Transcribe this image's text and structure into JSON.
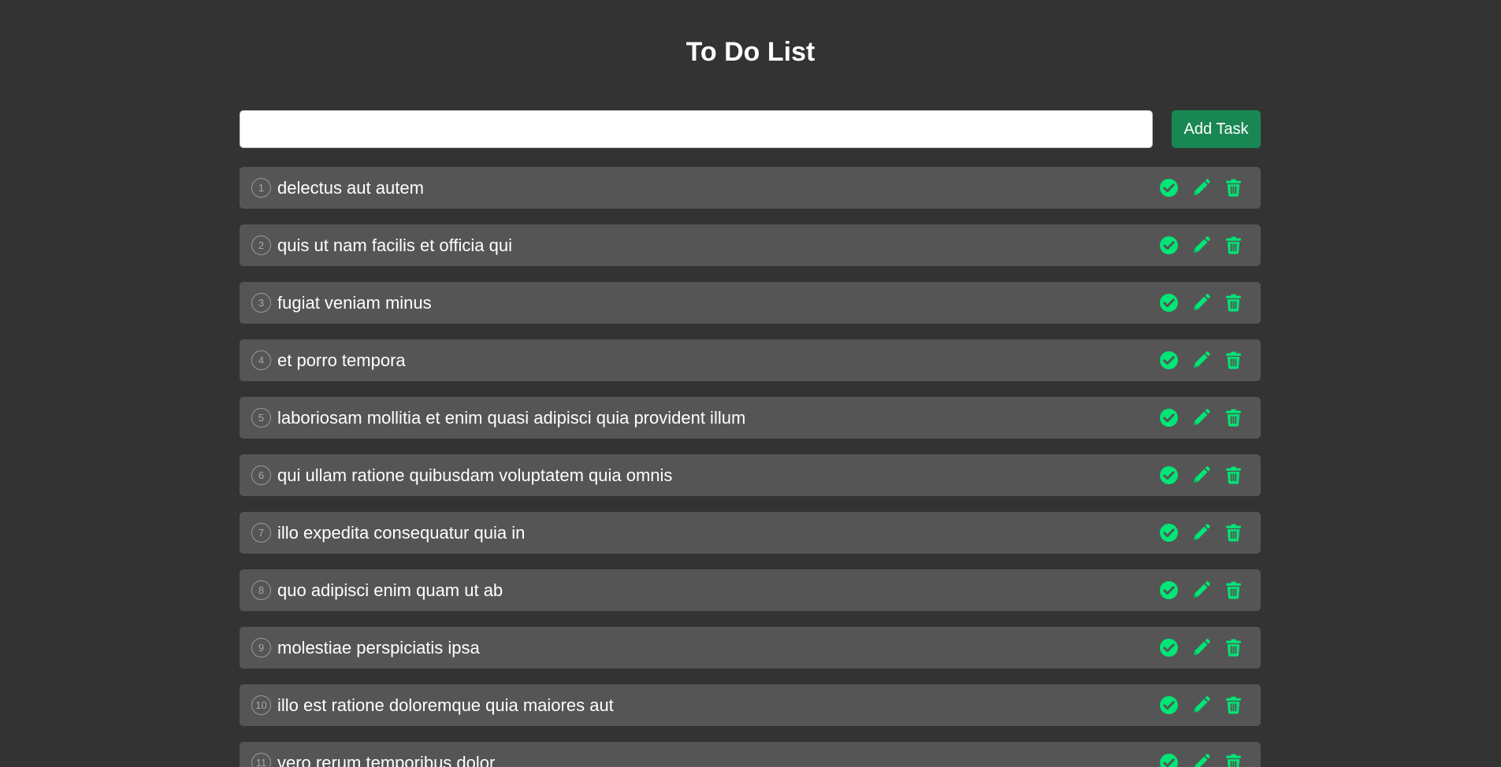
{
  "app": {
    "title": "To Do List"
  },
  "add_form": {
    "input_value": "",
    "placeholder": "",
    "button_label": "Add Task"
  },
  "colors": {
    "background": "#333333",
    "item_background": "#555555",
    "accent": "#00e676",
    "button": "#198754"
  },
  "icons": {
    "complete": "check-circle-icon",
    "edit": "pencil-icon",
    "delete": "trash-icon"
  },
  "tasks": [
    {
      "number": "1",
      "text": "delectus aut autem"
    },
    {
      "number": "2",
      "text": "quis ut nam facilis et officia qui"
    },
    {
      "number": "3",
      "text": "fugiat veniam minus"
    },
    {
      "number": "4",
      "text": "et porro tempora"
    },
    {
      "number": "5",
      "text": "laboriosam mollitia et enim quasi adipisci quia provident illum"
    },
    {
      "number": "6",
      "text": "qui ullam ratione quibusdam voluptatem quia omnis"
    },
    {
      "number": "7",
      "text": "illo expedita consequatur quia in"
    },
    {
      "number": "8",
      "text": "quo adipisci enim quam ut ab"
    },
    {
      "number": "9",
      "text": "molestiae perspiciatis ipsa"
    },
    {
      "number": "10",
      "text": "illo est ratione doloremque quia maiores aut"
    },
    {
      "number": "11",
      "text": "vero rerum temporibus dolor"
    }
  ]
}
